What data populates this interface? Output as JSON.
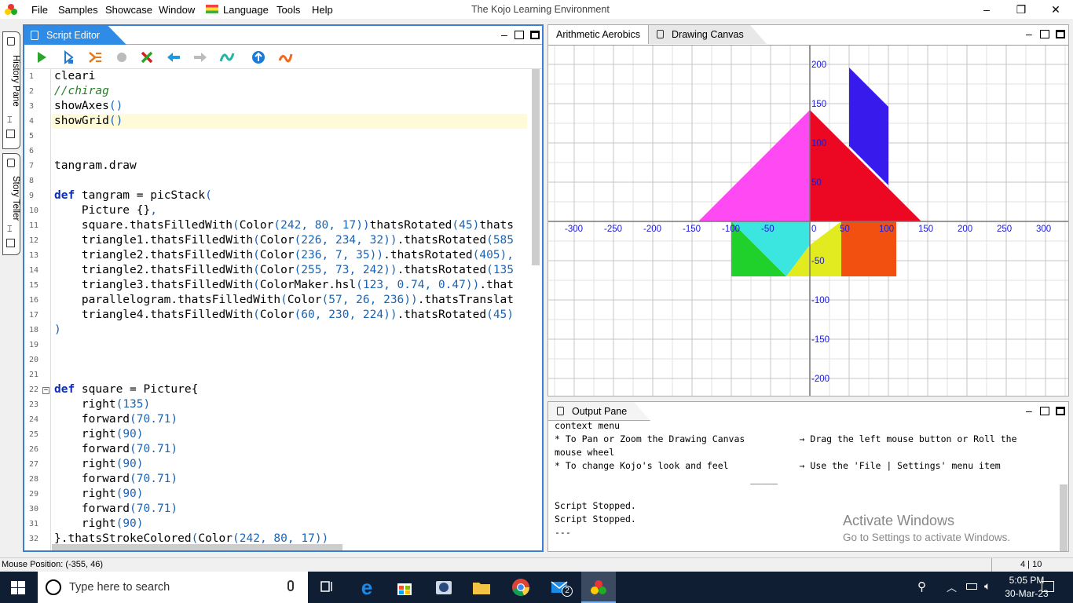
{
  "menubar": {
    "items": [
      "File",
      "Samples",
      "Showcase",
      "Window",
      "Language",
      "Tools",
      "Help"
    ],
    "title": "The Kojo Learning Environment"
  },
  "sidebar": {
    "history": "History Pane",
    "story": "Story Teller"
  },
  "editor": {
    "tab_label": "Script Editor",
    "lines": [
      {
        "n": "1",
        "t": "cleari"
      },
      {
        "n": "2",
        "t": "//chirag"
      },
      {
        "n": "3",
        "t": "showAxes()"
      },
      {
        "n": "4",
        "t": "showGrid()"
      },
      {
        "n": "5",
        "t": ""
      },
      {
        "n": "6",
        "t": ""
      },
      {
        "n": "7",
        "t": "tangram.draw"
      },
      {
        "n": "8",
        "t": ""
      },
      {
        "n": "9",
        "t": "def tangram = picStack("
      },
      {
        "n": "10",
        "t": "    Picture {},"
      },
      {
        "n": "11",
        "t": "    square.thatsFilledWith(Color(242, 80, 17))thatsRotated(45)thats"
      },
      {
        "n": "12",
        "t": "    triangle1.thatsFilledWith(Color(226, 234, 32)).thatsRotated(585"
      },
      {
        "n": "13",
        "t": "    triangle2.thatsFilledWith(Color(236, 7, 35)).thatsRotated(405),"
      },
      {
        "n": "14",
        "t": "    triangle2.thatsFilledWith(Color(255, 73, 242)).thatsRotated(135"
      },
      {
        "n": "15",
        "t": "    triangle3.thatsFilledWith(ColorMaker.hsl(123, 0.74, 0.47)).that"
      },
      {
        "n": "16",
        "t": "    parallelogram.thatsFilledWith(Color(57, 26, 236)).thatsTranslat"
      },
      {
        "n": "17",
        "t": "    triangle4.thatsFilledWith(Color(60, 230, 224)).thatsRotated(45)"
      },
      {
        "n": "18",
        "t": ")"
      },
      {
        "n": "19",
        "t": ""
      },
      {
        "n": "20",
        "t": ""
      },
      {
        "n": "21",
        "t": ""
      },
      {
        "n": "22",
        "t": "def square = Picture{"
      },
      {
        "n": "23",
        "t": "    right(135)"
      },
      {
        "n": "24",
        "t": "    forward(70.71)"
      },
      {
        "n": "25",
        "t": "    right(90)"
      },
      {
        "n": "26",
        "t": "    forward(70.71)"
      },
      {
        "n": "27",
        "t": "    right(90)"
      },
      {
        "n": "28",
        "t": "    forward(70.71)"
      },
      {
        "n": "29",
        "t": "    right(90)"
      },
      {
        "n": "30",
        "t": "    forward(70.71)"
      },
      {
        "n": "31",
        "t": "    right(90)"
      },
      {
        "n": "32",
        "t": "}.thatsStrokeColored(Color(242, 80, 17))"
      }
    ]
  },
  "right_tabs": {
    "arith": "Arithmetic Aerobics",
    "canvas": "Drawing Canvas"
  },
  "canvas": {
    "x_ticks": [
      "-300",
      "-250",
      "-200",
      "-150",
      "-100",
      "-50",
      "0",
      "50",
      "100",
      "150",
      "200",
      "250",
      "300"
    ],
    "y_ticks": [
      "200",
      "150",
      "100",
      "50",
      "-50",
      "-100",
      "-150",
      "-200"
    ]
  },
  "output": {
    "tab_label": "Output Pane",
    "lines": [
      "context menu",
      "* To Pan or Zoom the Drawing Canvas          → Drag the left mouse button or Roll the",
      "mouse wheel",
      "* To change Kojo's look and feel             → Use the 'File | Settings' menu item",
      "                                    _____",
      "",
      "Script Stopped.",
      "Script Stopped.",
      "---"
    ],
    "watermark1": "Activate Windows",
    "watermark2": "Go to Settings to activate Windows."
  },
  "status": {
    "mouse": "Mouse Position: (-355, 46)",
    "pos": "4 | 10"
  },
  "taskbar": {
    "search": "Type here to search",
    "time": "5:05 PM",
    "date": "30-Mar-23",
    "mail_badge": "2"
  },
  "colors": {
    "accent": "#2e8be6",
    "orange": "#f25011",
    "yellow": "#e2ea20",
    "red": "#ec0723",
    "magenta": "#ff49f2",
    "green": "#1fd12a",
    "blue": "#391aec",
    "cyan": "#3ce6e0"
  }
}
